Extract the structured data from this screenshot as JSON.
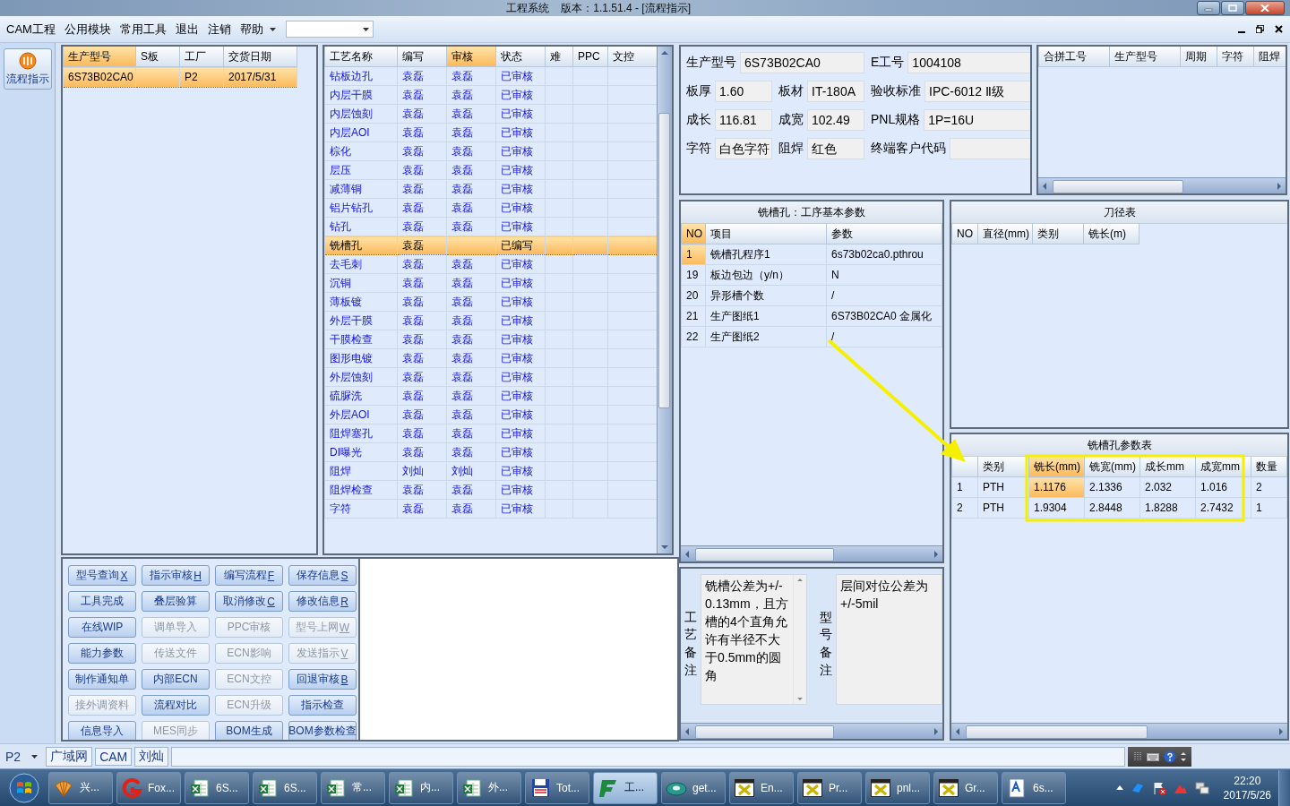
{
  "window": {
    "title": "工程系统    版本：1.1.51.4 - [流程指示]"
  },
  "menu": [
    {
      "label": "CAM工程",
      "kind": "item"
    },
    {
      "label": "公用模块",
      "kind": "item"
    },
    {
      "label": "常用工具",
      "kind": "item"
    },
    {
      "label": "退出",
      "kind": "item"
    },
    {
      "label": "注销",
      "kind": "item"
    },
    {
      "label": "帮助",
      "kind": "dropdown"
    }
  ],
  "side_button": {
    "label": "流程指示"
  },
  "orders": {
    "columns": [
      {
        "label": "生产型号",
        "selected": true
      },
      {
        "label": "S板",
        "selected": false
      },
      {
        "label": "工厂",
        "selected": false
      },
      {
        "label": "交货日期",
        "selected": false
      }
    ],
    "rows": [
      {
        "cells": [
          "6S73B02CA0",
          null,
          "P2",
          "2017/5/31"
        ],
        "selected": true
      }
    ]
  },
  "processes": {
    "columns": [
      {
        "label": "工艺名称",
        "selected": false
      },
      {
        "label": "编写",
        "selected": false
      },
      {
        "label": "审核",
        "selected": true
      },
      {
        "label": "状态",
        "selected": false
      },
      {
        "label": "难",
        "selected": false
      },
      {
        "label": "PPC",
        "selected": false
      },
      {
        "label": "文控",
        "selected": false
      }
    ],
    "rows": [
      {
        "cells": [
          "钻板边孔",
          "袁磊",
          "袁磊",
          "已审核"
        ],
        "selected": false
      },
      {
        "cells": [
          "内层干膜",
          "袁磊",
          "袁磊",
          "已审核"
        ],
        "selected": false
      },
      {
        "cells": [
          "内层蚀刻",
          "袁磊",
          "袁磊",
          "已审核"
        ],
        "selected": false
      },
      {
        "cells": [
          "内层AOI",
          "袁磊",
          "袁磊",
          "已审核"
        ],
        "selected": false
      },
      {
        "cells": [
          "棕化",
          "袁磊",
          "袁磊",
          "已审核"
        ],
        "selected": false
      },
      {
        "cells": [
          "层压",
          "袁磊",
          "袁磊",
          "已审核"
        ],
        "selected": false
      },
      {
        "cells": [
          "减薄铜",
          "袁磊",
          "袁磊",
          "已审核"
        ],
        "selected": false
      },
      {
        "cells": [
          "铝片钻孔",
          "袁磊",
          "袁磊",
          "已审核"
        ],
        "selected": false
      },
      {
        "cells": [
          "钻孔",
          "袁磊",
          "袁磊",
          "已审核"
        ],
        "selected": false
      },
      {
        "cells": [
          "铣槽孔",
          "袁磊",
          null,
          "已编写"
        ],
        "selected": true
      },
      {
        "cells": [
          "去毛刺",
          "袁磊",
          "袁磊",
          "已审核"
        ],
        "selected": false
      },
      {
        "cells": [
          "沉铜",
          "袁磊",
          "袁磊",
          "已审核"
        ],
        "selected": false
      },
      {
        "cells": [
          "薄板镀",
          "袁磊",
          "袁磊",
          "已审核"
        ],
        "selected": false
      },
      {
        "cells": [
          "外层干膜",
          "袁磊",
          "袁磊",
          "已审核"
        ],
        "selected": false
      },
      {
        "cells": [
          "干膜检查",
          "袁磊",
          "袁磊",
          "已审核"
        ],
        "selected": false
      },
      {
        "cells": [
          "图形电镀",
          "袁磊",
          "袁磊",
          "已审核"
        ],
        "selected": false
      },
      {
        "cells": [
          "外层蚀刻",
          "袁磊",
          "袁磊",
          "已审核"
        ],
        "selected": false
      },
      {
        "cells": [
          "硫脲洗",
          "袁磊",
          "袁磊",
          "已审核"
        ],
        "selected": false
      },
      {
        "cells": [
          "外层AOI",
          "袁磊",
          "袁磊",
          "已审核"
        ],
        "selected": false
      },
      {
        "cells": [
          "阻焊塞孔",
          "袁磊",
          "袁磊",
          "已审核"
        ],
        "selected": false
      },
      {
        "cells": [
          "DI曝光",
          "袁磊",
          "袁磊",
          "已审核"
        ],
        "selected": false
      },
      {
        "cells": [
          "阻焊",
          "刘灿",
          "刘灿",
          "已审核"
        ],
        "selected": false
      },
      {
        "cells": [
          "阻焊检查",
          "袁磊",
          "袁磊",
          "已审核"
        ],
        "selected": false
      },
      {
        "cells": [
          "字符",
          "袁磊",
          "袁磊",
          "已审核"
        ],
        "selected": false
      }
    ]
  },
  "buttons": [
    {
      "label": "型号查询",
      "key": "X",
      "disabled": false
    },
    {
      "label": "指示审核",
      "key": "H",
      "disabled": false
    },
    {
      "label": "编写流程",
      "key": "F",
      "disabled": false
    },
    {
      "label": "保存信息",
      "key": "S",
      "disabled": false
    },
    {
      "label": "工具完成",
      "disabled": false
    },
    {
      "label": "叠层验算",
      "disabled": false
    },
    {
      "label": "取消修改",
      "key": "C",
      "disabled": false
    },
    {
      "label": "修改信息",
      "key": "R",
      "disabled": false
    },
    {
      "label": "在线WIP",
      "disabled": false
    },
    {
      "label": "调单导入",
      "disabled": true
    },
    {
      "label": "PPC审核",
      "disabled": true
    },
    {
      "label": "型号上网",
      "key": "W",
      "disabled": true
    },
    {
      "label": "能力参数",
      "disabled": false
    },
    {
      "label": "传送文件",
      "disabled": true
    },
    {
      "label": "ECN影响",
      "disabled": true
    },
    {
      "label": "发送指示",
      "key": "V",
      "disabled": true
    },
    {
      "label": "制作通知单",
      "disabled": false
    },
    {
      "label": "内部ECN",
      "disabled": false
    },
    {
      "label": "ECN文控",
      "disabled": true
    },
    {
      "label": "回退审核",
      "key": "B",
      "disabled": false
    },
    {
      "label": "接外调资料",
      "disabled": true
    },
    {
      "label": "流程对比",
      "disabled": false
    },
    {
      "label": "ECN升级",
      "disabled": true
    },
    {
      "label": "指示检查",
      "disabled": false
    },
    {
      "label": "信息导入",
      "disabled": false
    },
    {
      "label": "MES同步",
      "disabled": true
    },
    {
      "label": "BOM生成",
      "disabled": false
    },
    {
      "label": "BOM参数检查",
      "disabled": false
    }
  ],
  "info": [
    [
      {
        "label": "生产型号",
        "value": "6S73B02CA0"
      },
      {
        "label": "E工号",
        "value": "1004108"
      }
    ],
    [
      {
        "label": "板厚",
        "value": "1.60"
      },
      {
        "label": "板材",
        "value": "IT-180A"
      },
      {
        "label": "验收标准",
        "value": "IPC-6012 Ⅱ级"
      }
    ],
    [
      {
        "label": "成长",
        "value": "116.81"
      },
      {
        "label": "成宽",
        "value": "102.49"
      },
      {
        "label": "PNL规格",
        "value": "1P=16U"
      }
    ],
    [
      {
        "label": "字符",
        "value": "白色字符"
      },
      {
        "label": "阻焊",
        "value": "红色"
      },
      {
        "label": "终端客户代码"
      }
    ]
  ],
  "merge_table": {
    "columns": [
      {
        "label": "合拼工号",
        "selected": false
      },
      {
        "label": "生产型号",
        "selected": false
      },
      {
        "label": "周期",
        "selected": false
      },
      {
        "label": "字符",
        "selected": false
      },
      {
        "label": "阻焊",
        "selected": false
      }
    ]
  },
  "params": {
    "title": "铣槽孔：工序基本参数",
    "columns": [
      {
        "label": "NO",
        "selected": true
      },
      {
        "label": "项目",
        "selected": false
      },
      {
        "label": "参数",
        "selected": false
      }
    ],
    "rows": [
      {
        "cells": [
          "1",
          "铣槽孔程序1",
          "6s73b02ca0.pthrou"
        ],
        "selected": true
      },
      {
        "cells": [
          "19",
          "板边包边（y/n）",
          "N"
        ],
        "selected": false
      },
      {
        "cells": [
          "20",
          "异形槽个数",
          "/"
        ],
        "selected": false
      },
      {
        "cells": [
          "21",
          "生产图纸1",
          "6S73B02CA0 金属化"
        ],
        "selected": false
      },
      {
        "cells": [
          "22",
          "生产图纸2",
          "/"
        ],
        "selected": false
      }
    ]
  },
  "tools": {
    "title": "刀径表",
    "columns": [
      {
        "label": "NO",
        "selected": false
      },
      {
        "label": "直径(mm)",
        "selected": false
      },
      {
        "label": "类别",
        "selected": false
      },
      {
        "label": "铣长(m)",
        "selected": false
      }
    ]
  },
  "slots": {
    "title": "铣槽孔参数表",
    "columns": [
      {
        "selected": false
      },
      {
        "label": "类别",
        "selected": false
      },
      {
        "label": "铣长(mm)",
        "selected": true
      },
      {
        "label": "铣宽(mm)",
        "selected": false
      },
      {
        "label": "成长mm",
        "selected": false
      },
      {
        "label": "成宽mm",
        "selected": false
      },
      {
        "label": "数量",
        "selected": false
      }
    ],
    "rows": [
      {
        "cells": [
          "1",
          "PTH",
          "1.1176",
          "2.1336",
          "2.032",
          "1.016",
          "2"
        ],
        "selected": true
      },
      {
        "cells": [
          "2",
          "PTH",
          "1.9304",
          "2.8448",
          "1.8288",
          "2.7432",
          "1"
        ],
        "selected": false
      }
    ]
  },
  "notes": [
    {
      "label": "工艺备注",
      "text": "铣槽公差为+/-0.13mm，且方槽的4个直角允许有半径不大于0.5mm的圆角"
    },
    {
      "label": "型号备注",
      "text": "层间对位公差为+/-5mil"
    }
  ],
  "status_bar": {
    "site": "P2",
    "segments": [
      "广域网",
      "CAM",
      "刘灿"
    ]
  },
  "taskbar": {
    "items": [
      {
        "label": "兴...",
        "kind": "shell",
        "active": false
      },
      {
        "label": "Fox...",
        "kind": "logo",
        "active": false
      },
      {
        "label": "6S...",
        "kind": "sheet",
        "active": false
      },
      {
        "label": "6S...",
        "kind": "sheet",
        "active": false
      },
      {
        "label": "常...",
        "kind": "sheet",
        "active": false
      },
      {
        "label": "内...",
        "kind": "sheet",
        "active": false
      },
      {
        "label": "外...",
        "kind": "sheet",
        "active": false
      },
      {
        "label": "Tot...",
        "kind": "disk",
        "active": false
      },
      {
        "label": "工...",
        "kind": "app",
        "active": true
      },
      {
        "label": "get...",
        "kind": "disc",
        "active": false
      },
      {
        "label": "En...",
        "kind": "xwin",
        "active": false
      },
      {
        "label": "Pr...",
        "kind": "xwin",
        "active": false
      },
      {
        "label": "pnl...",
        "kind": "xwin",
        "active": false
      },
      {
        "label": "Gr...",
        "kind": "xwin",
        "active": false
      },
      {
        "label": "6s...",
        "kind": "doc",
        "active": false
      }
    ],
    "time": "22:20",
    "date": "2017/5/26"
  }
}
